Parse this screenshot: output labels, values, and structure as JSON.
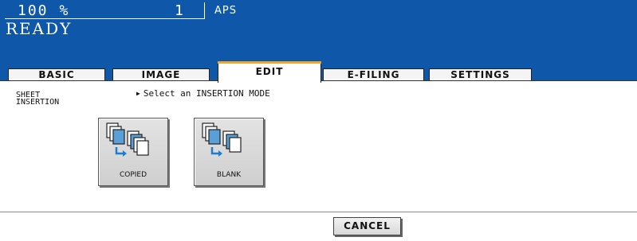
{
  "status": {
    "zoom": "100",
    "zoom_unit": "%",
    "copies": "1",
    "paper": "APS",
    "state": "READY"
  },
  "tabs": [
    {
      "label": "BASIC",
      "active": false
    },
    {
      "label": "IMAGE",
      "active": false
    },
    {
      "label": "EDIT",
      "active": true
    },
    {
      "label": "E-FILING",
      "active": false
    },
    {
      "label": "SETTINGS",
      "active": false
    }
  ],
  "content": {
    "function_label_line1": "SHEET",
    "function_label_line2": "INSERTION",
    "prompt": "Select an INSERTION MODE",
    "modes": [
      {
        "label": "COPIED",
        "icon": "copied-sheet-insertion-icon"
      },
      {
        "label": "BLANK",
        "icon": "blank-sheet-insertion-icon"
      }
    ],
    "cancel_label": "CANCEL"
  },
  "colors": {
    "header_blue": "#0f57a8",
    "active_tab_accent": "#f5a623",
    "page_icon_blue": "#5aa0d8"
  }
}
